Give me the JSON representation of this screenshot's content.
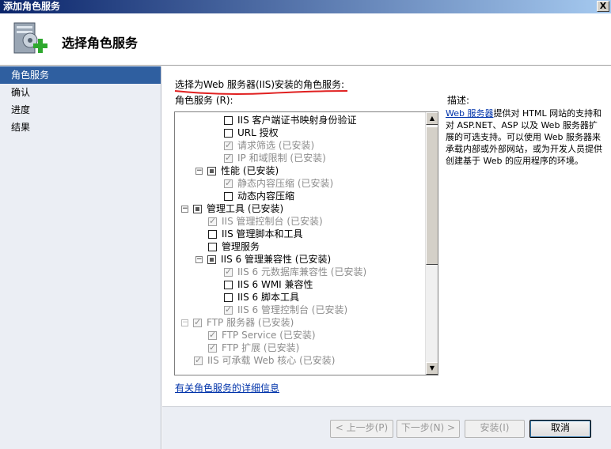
{
  "window": {
    "title": "添加角色服务",
    "close_label": "X"
  },
  "header": {
    "title": "选择角色服务"
  },
  "nav": {
    "items": [
      "角色服务",
      "确认",
      "进度",
      "结果"
    ]
  },
  "main": {
    "instruction": "选择为Web 服务器(IIS)安装的角色服务:",
    "list_label": "角色服务 (R):",
    "tree": [
      {
        "label": "IIS 客户端证书映射身份验证",
        "state": "unchecked",
        "disabled": false,
        "expander": null
      },
      {
        "label": "URL 授权",
        "state": "unchecked",
        "disabled": false,
        "expander": null
      },
      {
        "label": "请求筛选   (已安装)",
        "state": "checked",
        "disabled": true,
        "expander": null
      },
      {
        "label": "IP 和域限制   (已安装)",
        "state": "checked",
        "disabled": true,
        "expander": null
      },
      {
        "label": "性能   (已安装)",
        "state": "partial",
        "disabled": false,
        "expander": "⊟"
      },
      {
        "label": "静态内容压缩   (已安装)",
        "state": "checked",
        "disabled": true,
        "expander": null
      },
      {
        "label": "动态内容压缩",
        "state": "unchecked",
        "disabled": false,
        "expander": null
      },
      {
        "label": "管理工具   (已安装)",
        "state": "partial",
        "disabled": false,
        "expander": "⊟"
      },
      {
        "label": "IIS 管理控制台   (已安装)",
        "state": "checked",
        "disabled": true,
        "expander": null
      },
      {
        "label": "IIS 管理脚本和工具",
        "state": "unchecked",
        "disabled": false,
        "expander": null
      },
      {
        "label": "管理服务",
        "state": "unchecked",
        "disabled": false,
        "expander": null
      },
      {
        "label": "IIS 6 管理兼容性   (已安装)",
        "state": "partial",
        "disabled": false,
        "expander": "⊟"
      },
      {
        "label": "IIS 6 元数据库兼容性   (已安装)",
        "state": "checked",
        "disabled": true,
        "expander": null
      },
      {
        "label": "IIS 6 WMI 兼容性",
        "state": "unchecked",
        "disabled": false,
        "expander": null
      },
      {
        "label": "IIS 6 脚本工具",
        "state": "unchecked",
        "disabled": false,
        "expander": null
      },
      {
        "label": "IIS 6 管理控制台   (已安装)",
        "state": "checked",
        "disabled": true,
        "expander": null
      },
      {
        "label": "FTP 服务器   (已安装)",
        "state": "checked",
        "disabled": true,
        "expander": "⊟"
      },
      {
        "label": "FTP Service   (已安装)",
        "state": "checked",
        "disabled": true,
        "expander": null
      },
      {
        "label": "FTP 扩展   (已安装)",
        "state": "checked",
        "disabled": true,
        "expander": null
      },
      {
        "label": "IIS 可承载 Web 核心   (已安装)",
        "state": "checked",
        "disabled": true,
        "expander": null
      }
    ],
    "more_info_link": "有关角色服务的详细信息",
    "description": {
      "title": "描述:",
      "link": "Web 服务器",
      "text": "提供对 HTML 网站的支持和对 ASP.NET、ASP 以及 Web 服务器扩展的可选支持。可以使用 Web 服务器来承载内部或外部网站，或为开发人员提供创建基于 Web 的应用程序的环境。"
    }
  },
  "footer": {
    "prev_label": "< 上一步(P)",
    "next_label": "下一步(N) >",
    "install_label": "安装(I)",
    "cancel_label": "取消"
  },
  "colors": {
    "title_bar": "#0a246a",
    "nav_active": "#2f5fa0",
    "annotation_red": "#e02020"
  }
}
